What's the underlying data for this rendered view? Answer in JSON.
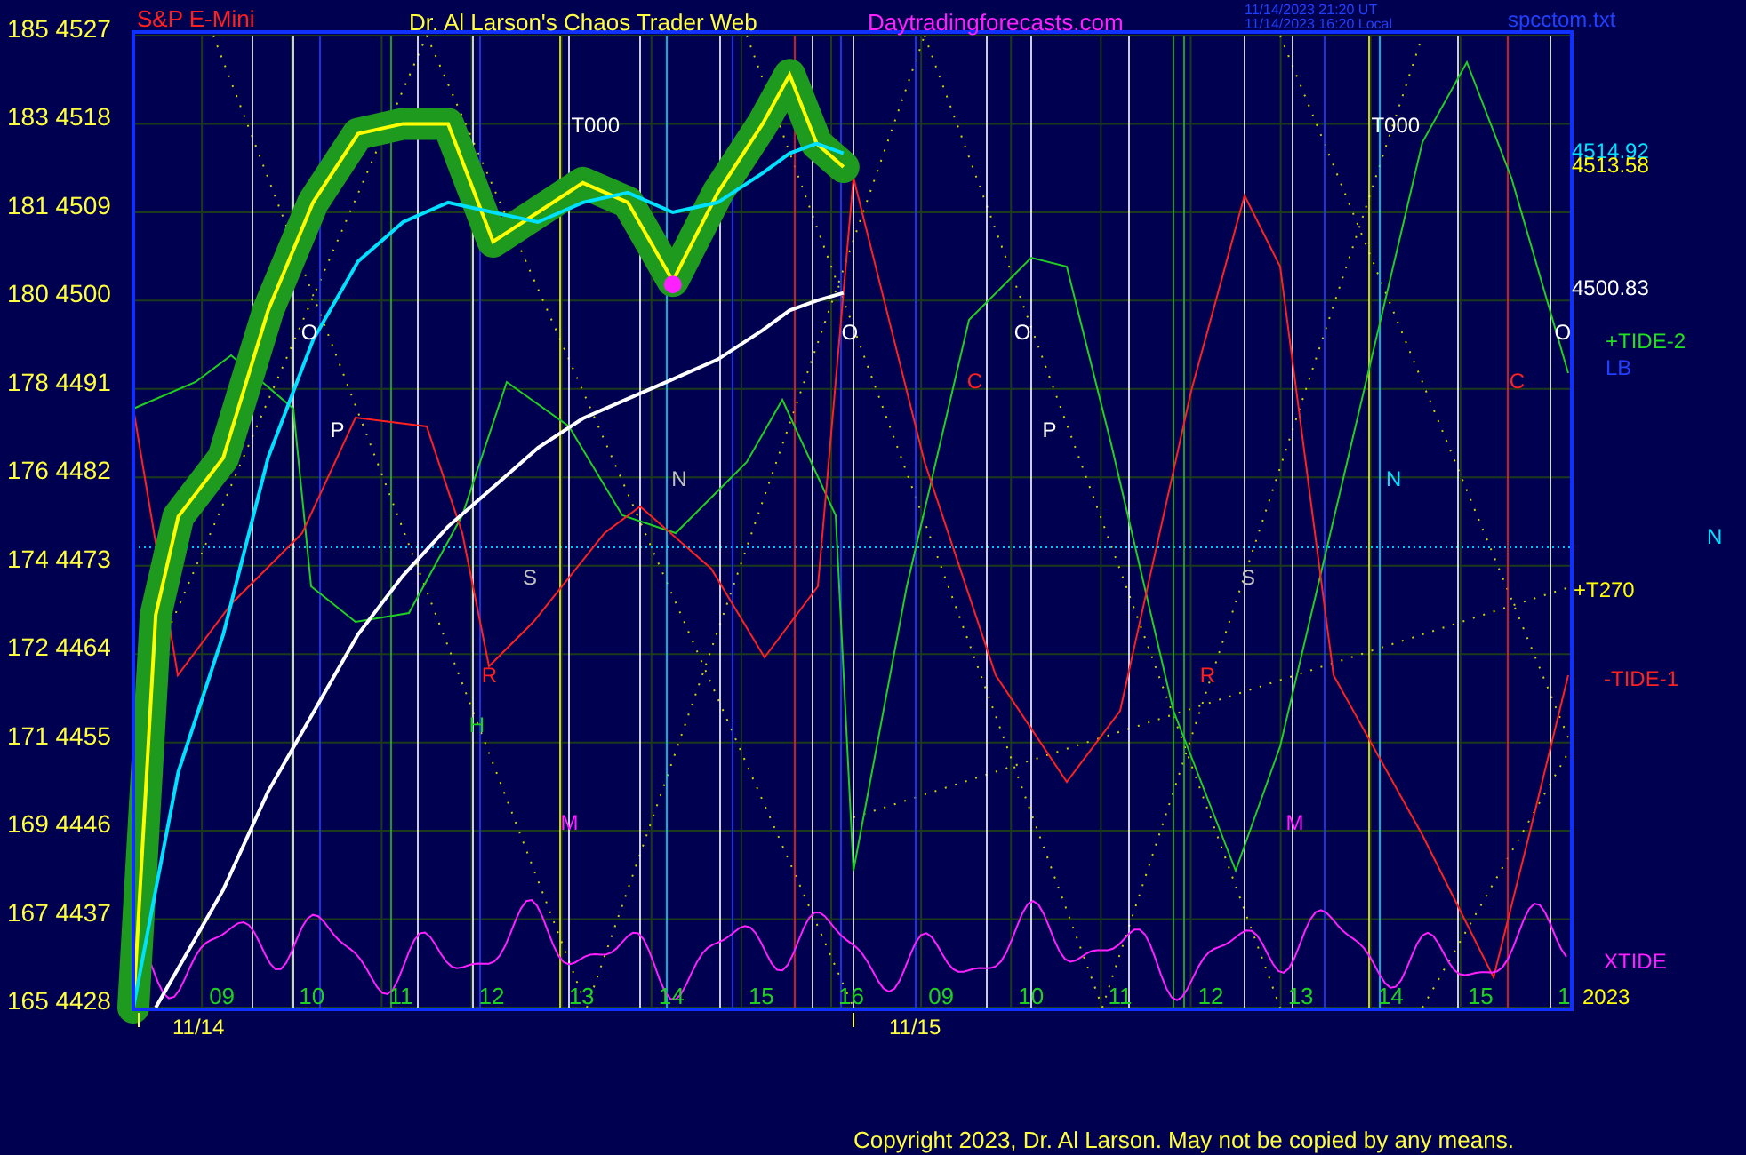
{
  "header": {
    "symbol": "S&P E-Mini",
    "title": "Dr. Al Larson's Chaos Trader Web",
    "site": "Daytradingforecasts.com",
    "time_ut": "11/14/2023 21:20 UT",
    "time_local": "11/14/2023 16:20 Local",
    "file": "spcctom.txt"
  },
  "chart": {
    "y_labels": [
      "185 4527",
      "183 4518",
      "181 4509",
      "180 4500",
      "178 4491",
      "176 4482",
      "174 4473",
      "172 4464",
      "171 4455",
      "169 4446",
      "167 4437",
      "165 4428"
    ],
    "x_labels": [
      "09",
      "10",
      "11",
      "12",
      "13",
      "14",
      "15",
      "16",
      "09",
      "10",
      "11",
      "12",
      "13",
      "14",
      "15",
      "1"
    ],
    "markers": [
      {
        "text": "T000",
        "color": "#ffffff"
      },
      {
        "text": "T000",
        "color": "#ffffff"
      },
      {
        "text": "O",
        "color": "#ffffff"
      },
      {
        "text": "O",
        "color": "#ffffff"
      },
      {
        "text": "O",
        "color": "#ffffff"
      },
      {
        "text": "O",
        "color": "#ffffff"
      },
      {
        "text": "P",
        "color": "#ffffff"
      },
      {
        "text": "P",
        "color": "#ffffff"
      },
      {
        "text": "C",
        "color": "#ff2020"
      },
      {
        "text": "C",
        "color": "#ff2020"
      },
      {
        "text": "S",
        "color": "#c0c0c0"
      },
      {
        "text": "S",
        "color": "#c0c0c0"
      },
      {
        "text": "N",
        "color": "#c0c0c0"
      },
      {
        "text": "N",
        "color": "#00e0ff"
      },
      {
        "text": "R",
        "color": "#ff2020"
      },
      {
        "text": "R",
        "color": "#ff2020"
      },
      {
        "text": "H",
        "color": "#20d020"
      },
      {
        "text": "M",
        "color": "#ff20ff"
      },
      {
        "text": "M",
        "color": "#ff20ff"
      }
    ],
    "date_labels": [
      "11/14",
      "11/15"
    ],
    "side_labels": [
      {
        "text": "4514.92",
        "color": "#00e0ff"
      },
      {
        "text": "4513.58",
        "color": "#ffff00"
      },
      {
        "text": "4500.83",
        "color": "#ffffff"
      },
      {
        "text": "+TIDE-2",
        "color": "#20e020"
      },
      {
        "text": "LB",
        "color": "#2040ff"
      },
      {
        "text": "N",
        "color": "#00e0ff"
      },
      {
        "text": "+T270",
        "color": "#ffff00"
      },
      {
        "text": "-TIDE-1",
        "color": "#ff2020"
      },
      {
        "text": "XTIDE",
        "color": "#ff20ff"
      },
      {
        "text": "2023",
        "color": "#ffff00"
      }
    ]
  },
  "copyright": "Copyright 2023, Dr. Al Larson. May not be copied by any means."
}
